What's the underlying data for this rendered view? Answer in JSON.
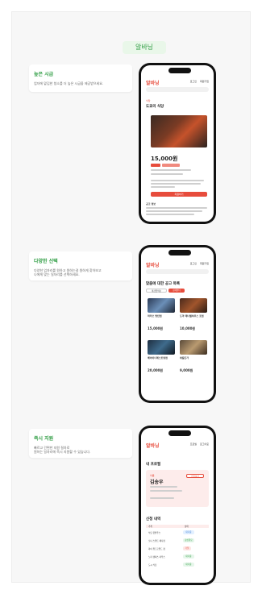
{
  "header": {
    "badge": "알바닝"
  },
  "sections": [
    {
      "title": "높은 시급",
      "desc": "업자에 맡김한 청소를 더 높은 시급을 제공받으세요.",
      "phone": {
        "logo": "알바닝",
        "nav": [
          "로그인",
          "회원가입"
        ],
        "tag": "식당",
        "heading": "도쿄의 식당",
        "price": "15,000원",
        "cta": "지원하기",
        "notice": "공고 정보"
      }
    },
    {
      "title": "다양한 선택",
      "desc": "다양한 업자리를 원하고 원하는걸 원하게 찾아보고\n나에게 맞는 일자리를 선택하세요.",
      "phone": {
        "logo": "알바닝",
        "nav": [
          "로그인",
          "회원가입"
        ],
        "heading": "맞춤에 대한 공고 목록",
        "filter": "마감임박순",
        "filter2": "상세필터",
        "items": [
          {
            "name": "마라오 방탄점",
            "price": "15,000원"
          },
          {
            "name": "도약 제너럴하우스 포점",
            "price": "10,000원"
          },
          {
            "name": "베어이너레스토랑점",
            "price": "20,000원"
          },
          {
            "name": "와칼돈가",
            "price": "9,000원"
          }
        ]
      }
    },
    {
      "title": "즉시 지원",
      "desc": "빠르고 간편한 지원 절차로\n원하는 일자리에 즉시 지원할 수 있습니다.",
      "phone": {
        "logo": "알바닝",
        "nav": [
          "프로필",
          "로그아웃"
        ],
        "profile_title": "내 프로필",
        "profile_tag": "이름",
        "name": "김송우",
        "edit": "편집하기",
        "history_title": "신청 내역",
        "cols": [
          "가게",
          "상태"
        ],
        "rows": [
          {
            "shop": "식당 꿈밭주스",
            "status": "대기중"
          },
          {
            "shop": "오너 스위트 헤나점",
            "status": "승인완료"
          },
          {
            "shop": "라이 위드로밀드 점",
            "status": "거절"
          },
          {
            "shop": "노라 캠퍼스 하우스",
            "status": "대기중"
          },
          {
            "shop": "도시 식당",
            "status": "대기중"
          }
        ]
      }
    }
  ]
}
